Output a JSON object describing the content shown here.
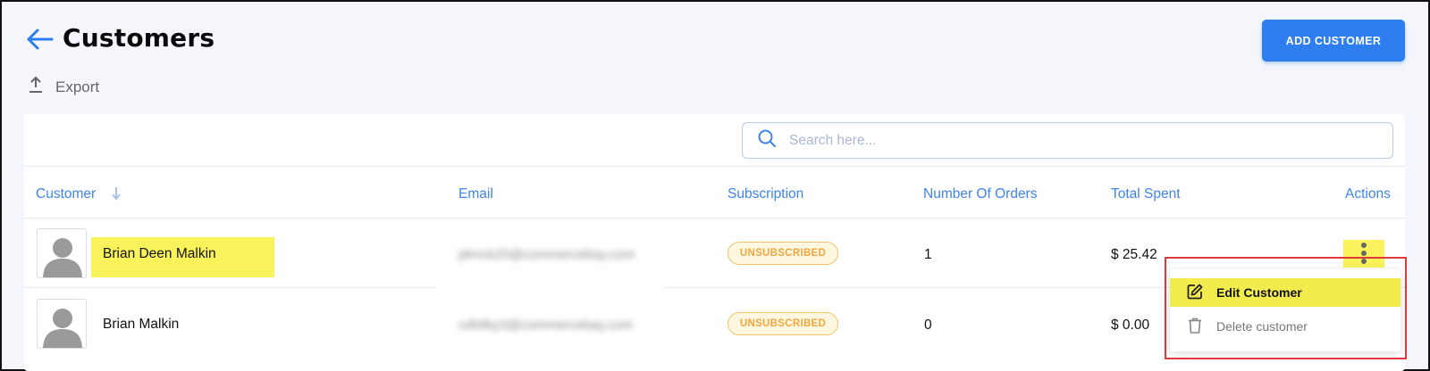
{
  "header": {
    "title": "Customers",
    "add_button_label": "ADD CUSTOMER",
    "export_label": "Export"
  },
  "search": {
    "placeholder": "Search here..."
  },
  "table": {
    "columns": [
      "Customer",
      "Email",
      "Subscription",
      "Number Of Orders",
      "Total Spent",
      "Actions"
    ],
    "rows": [
      {
        "name": "Brian Deen Malkin",
        "email": "jdrnck25@commercebay.com",
        "subscription": "UNSUBSCRIBED",
        "orders": "1",
        "total": "$ 25.42",
        "highlighted": true
      },
      {
        "name": "Brian Malkin",
        "email": "cdhilky3@commercebay.com",
        "subscription": "UNSUBSCRIBED",
        "orders": "0",
        "total": "$ 0.00",
        "highlighted": false
      }
    ]
  },
  "actions_menu": {
    "edit_label": "Edit Customer",
    "delete_label": "Delete customer"
  },
  "colors": {
    "accent": "#2f7ef0",
    "header_text": "#3f83ec",
    "highlight": "#f9f25a",
    "badge_text": "#f2a640",
    "annotation_border": "#e23a3a"
  },
  "icons": {
    "back": "back-arrow-icon",
    "export": "upload-icon",
    "search": "search-icon",
    "sort": "sort-down-icon",
    "avatar": "user-avatar-icon",
    "kebab": "more-vertical-icon",
    "edit": "edit-icon",
    "delete": "trash-icon"
  }
}
